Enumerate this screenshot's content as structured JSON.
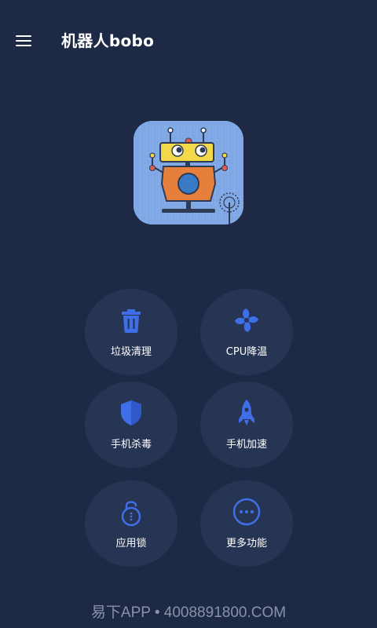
{
  "app": {
    "title": "机器人bobo"
  },
  "header": {
    "menu_icon": "hamburger-menu-icon"
  },
  "logo": {
    "icon": "robot-bobo-logo"
  },
  "features": [
    {
      "label": "垃圾清理",
      "icon": "trash-icon"
    },
    {
      "label": "CPU降温",
      "icon": "fan-icon"
    },
    {
      "label": "手机杀毒",
      "icon": "shield-icon"
    },
    {
      "label": "手机加速",
      "icon": "rocket-icon"
    },
    {
      "label": "应用锁",
      "icon": "lock-icon"
    },
    {
      "label": "更多功能",
      "icon": "more-icon"
    }
  ],
  "watermark": "易下APP • 4008891800.COM",
  "colors": {
    "background": "#1e2a45",
    "button": "#273554",
    "accent": "#3f6ee8",
    "text": "#ffffff"
  }
}
